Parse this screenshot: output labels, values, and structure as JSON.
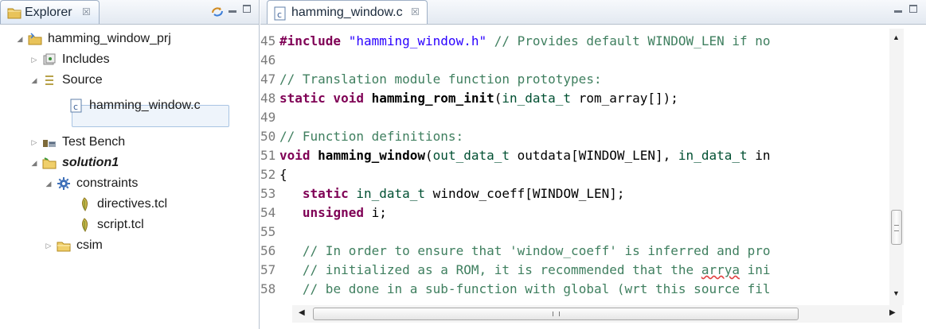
{
  "explorer": {
    "tab_label": "Explorer",
    "tab_close": "☒",
    "tree": [
      {
        "label": "hamming_window_prj",
        "twisty": "◢",
        "icon": "project-folder-icon"
      },
      {
        "label": "Includes",
        "twisty": "▷",
        "icon": "includes-icon"
      },
      {
        "label": "Source",
        "twisty": "◢",
        "icon": "source-icon"
      },
      {
        "label": "hamming_window.c",
        "twisty": "",
        "icon": "c-file-icon"
      },
      {
        "label": "Test Bench",
        "twisty": "▷",
        "icon": "test-bench-icon"
      },
      {
        "label": "solution1",
        "twisty": "◢",
        "icon": "solution-folder-icon"
      },
      {
        "label": "constraints",
        "twisty": "◢",
        "icon": "constraints-gear-icon"
      },
      {
        "label": "directives.tcl",
        "twisty": "",
        "icon": "tcl-file-icon"
      },
      {
        "label": "script.tcl",
        "twisty": "",
        "icon": "tcl-file-icon"
      },
      {
        "label": "csim",
        "twisty": "▷",
        "icon": "folder-icon"
      }
    ]
  },
  "editor": {
    "tab_label": "hamming_window.c",
    "tab_close": "☒",
    "lines": [
      {
        "num": "45",
        "parts": [
          {
            "t": "#include ",
            "c": "pp"
          },
          {
            "t": "\"hamming_window.h\"",
            "c": "str"
          },
          {
            "t": " ",
            "c": "tx"
          },
          {
            "t": "// Provides default WINDOW_LEN if no",
            "c": "cm"
          }
        ]
      },
      {
        "num": "46",
        "parts": []
      },
      {
        "num": "47",
        "parts": [
          {
            "t": "// Translation module function prototypes:",
            "c": "cm"
          }
        ]
      },
      {
        "num": "48",
        "parts": [
          {
            "t": "static void ",
            "c": "kw"
          },
          {
            "t": "hamming_rom_init",
            "c": "fn"
          },
          {
            "t": "(",
            "c": "tx"
          },
          {
            "t": "in_data_t",
            "c": "ty"
          },
          {
            "t": " rom_array[]);",
            "c": "tx"
          }
        ]
      },
      {
        "num": "49",
        "parts": []
      },
      {
        "num": "50",
        "parts": [
          {
            "t": "// Function definitions:",
            "c": "cm"
          }
        ]
      },
      {
        "num": "51",
        "parts": [
          {
            "t": "void ",
            "c": "kw"
          },
          {
            "t": "hamming_window",
            "c": "fn"
          },
          {
            "t": "(",
            "c": "tx"
          },
          {
            "t": "out_data_t",
            "c": "ty"
          },
          {
            "t": " outdata[WINDOW_LEN], ",
            "c": "tx"
          },
          {
            "t": "in_data_t",
            "c": "ty"
          },
          {
            "t": " in",
            "c": "tx"
          }
        ]
      },
      {
        "num": "52",
        "parts": [
          {
            "t": "{",
            "c": "tx"
          }
        ]
      },
      {
        "num": "53",
        "parts": [
          {
            "t": "   ",
            "c": "tx"
          },
          {
            "t": "static ",
            "c": "kw"
          },
          {
            "t": "in_data_t",
            "c": "ty"
          },
          {
            "t": " window_coeff[WINDOW_LEN];",
            "c": "tx"
          }
        ]
      },
      {
        "num": "54",
        "parts": [
          {
            "t": "   ",
            "c": "tx"
          },
          {
            "t": "unsigned",
            "c": "kw"
          },
          {
            "t": " i;",
            "c": "tx"
          }
        ]
      },
      {
        "num": "55",
        "parts": []
      },
      {
        "num": "56",
        "parts": [
          {
            "t": "   ",
            "c": "tx"
          },
          {
            "t": "// In order to ensure that 'window_coeff' is inferred and pro",
            "c": "cm"
          }
        ]
      },
      {
        "num": "57",
        "parts": [
          {
            "t": "   ",
            "c": "tx"
          },
          {
            "t": "// initialized as a ROM, it is recommended that the ",
            "c": "cm"
          },
          {
            "t": "arrya",
            "c": "cm squig"
          },
          {
            "t": " ini",
            "c": "cm"
          }
        ]
      },
      {
        "num": "58",
        "parts": [
          {
            "t": "   ",
            "c": "tx"
          },
          {
            "t": "// be done in a sub-function with global (wrt this source fil",
            "c": "cm"
          }
        ]
      }
    ]
  },
  "scrollbars": {
    "vertical_grip": "≡",
    "horizontal_grip": "III",
    "vertical_position": 0.62,
    "horizontal_position": 0.0
  },
  "colors": {
    "keyword": "#7f0055",
    "string": "#2a00ff",
    "comment": "#3f7f5f",
    "type": "#005032"
  }
}
